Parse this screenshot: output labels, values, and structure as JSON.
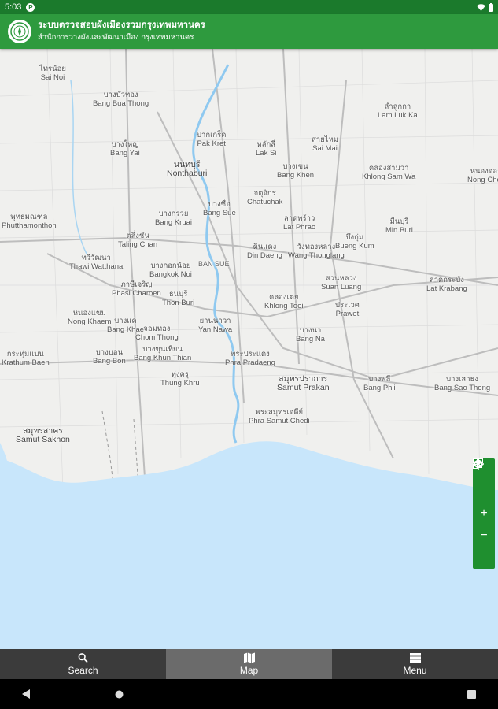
{
  "status_bar": {
    "time": "5:03",
    "app_badge": "P"
  },
  "header": {
    "title": "ระบบตรวจสอบผังเมืองรวมกรุงเทพมหานคร",
    "subtitle": "สำนักการวางผังและพัฒนาเมือง กรุงเทพมหานคร"
  },
  "map": {
    "places": [
      {
        "th": "ไทรน้อย",
        "en": "Sai Noi"
      },
      {
        "th": "บางบัวทอง",
        "en": "Bang Bua Thong"
      },
      {
        "th": "บางใหญ่",
        "en": "Bang Yai"
      },
      {
        "th": "ปากเกร็ด",
        "en": "Pak Kret"
      },
      {
        "th": "หลักสี่",
        "en": "Lak Si"
      },
      {
        "th": "สายไหม",
        "en": "Sai Mai"
      },
      {
        "th": "ลำลูกกา",
        "en": "Lam Luk Ka"
      },
      {
        "th": "นนทบุรี",
        "en": "Nonthaburi"
      },
      {
        "th": "บางเขน",
        "en": "Bang Khen"
      },
      {
        "th": "คลองสามวา",
        "en": "Khlong Sam Wa"
      },
      {
        "th": "หนองจอก",
        "en": "Nong Chok"
      },
      {
        "th": "จตุจักร",
        "en": "Chatuchak"
      },
      {
        "th": "บางกรวย",
        "en": "Bang Kruai"
      },
      {
        "th": "บางซื่อ",
        "en": "Bang Sue"
      },
      {
        "th": "ลาดพร้าว",
        "en": "Lat Phrao"
      },
      {
        "th": "มีนบุรี",
        "en": "Min Buri"
      },
      {
        "th": "พุทธมณฑล",
        "en": "Phutthamonthon"
      },
      {
        "th": "ตลิ่งชัน",
        "en": "Taling Chan"
      },
      {
        "th": "ดินแดง",
        "en": "Din Daeng"
      },
      {
        "th": "วังทองหลาง",
        "en": "Wang Thonglang"
      },
      {
        "th": "บึงกุ่ม",
        "en": "Bueng Kum"
      },
      {
        "th": "ทวีวัฒนา",
        "en": "Thawi Watthana"
      },
      {
        "th": "บางกอกน้อย",
        "en": "Bangkok Noi"
      },
      {
        "th": "สวนหลวง",
        "en": "Suan Luang"
      },
      {
        "th": "ลาดกระบัง",
        "en": "Lat Krabang"
      },
      {
        "th": "ภาษีเจริญ",
        "en": "Phasi Charoen"
      },
      {
        "th": "ธนบุรี",
        "en": "Thon Buri"
      },
      {
        "th": "คลองเตย",
        "en": "Khlong Toei"
      },
      {
        "th": "ประเวศ",
        "en": "Prawet"
      },
      {
        "th": "หนองแขม",
        "en": "Nong Khaem"
      },
      {
        "th": "บางแค",
        "en": "Bang Khae"
      },
      {
        "th": "จอมทอง",
        "en": "Chom Thong"
      },
      {
        "th": "ยานนาวา",
        "en": "Yan Nawa"
      },
      {
        "th": "บางนา",
        "en": "Bang Na"
      },
      {
        "th": "กระทุ่มแบน",
        "en": "Krathum Baen"
      },
      {
        "th": "บางบอน",
        "en": "Bang Bon"
      },
      {
        "th": "บางขุนเทียน",
        "en": "Bang Khun Thian"
      },
      {
        "th": "พระประแดง",
        "en": "Phra Pradaeng"
      },
      {
        "th": "ทุ่งครุ",
        "en": "Thung Khru"
      },
      {
        "th": "สมุทรปราการ",
        "en": "Samut Prakan"
      },
      {
        "th": "บางพลี",
        "en": "Bang Phli"
      },
      {
        "th": "บางเสาธง",
        "en": "Bang Sao Thong"
      },
      {
        "th": "สมุทรสาคร",
        "en": "Samut Sakhon"
      },
      {
        "th": "พระสมุทรเจดีย์",
        "en": "Phra Samut Chedi"
      }
    ],
    "district_label": "BAN SUE"
  },
  "icons": {
    "layers": "layers-icon",
    "qr": "qr-icon",
    "zoom_in": "plus-icon",
    "zoom_out": "minus-icon",
    "locate": "locate-icon"
  },
  "map_controls": {
    "zoom_in": "+",
    "zoom_out": "−"
  },
  "bottom_nav": {
    "search": "Search",
    "map": "Map",
    "menu": "Menu"
  },
  "colors": {
    "header": "#2e9a3e",
    "status": "#1b7a2c",
    "sea": "#c8e6fb",
    "nav": "#3b3b3b",
    "nav_active": "#6b6b6b"
  }
}
